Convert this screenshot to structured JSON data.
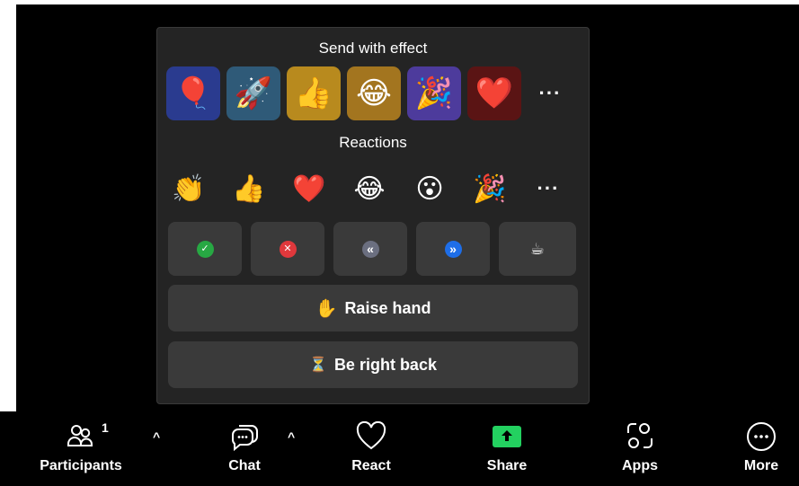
{
  "popup": {
    "effects_title": "Send with effect",
    "effects": [
      {
        "emoji": "🎈",
        "name": "balloon",
        "bg": "#2a3b8f"
      },
      {
        "emoji": "🚀",
        "name": "rocket",
        "bg": "#2f5a78"
      },
      {
        "emoji": "👍",
        "name": "thumbs-up",
        "bg": "#b88a1e"
      },
      {
        "emoji": "😂",
        "name": "laughing",
        "bg": "#a3751f"
      },
      {
        "emoji": "🎉",
        "name": "party",
        "bg": "#4d3b9c"
      },
      {
        "emoji": "❤️",
        "name": "heart",
        "bg": "#5a1414"
      }
    ],
    "effects_more": "···",
    "reactions_title": "Reactions",
    "reactions": [
      {
        "emoji": "👏",
        "name": "clap"
      },
      {
        "emoji": "👍",
        "name": "thumbs-up"
      },
      {
        "emoji": "❤️",
        "name": "heart"
      },
      {
        "emoji": "😂",
        "name": "laughing"
      },
      {
        "emoji": "😮",
        "name": "surprised"
      },
      {
        "emoji": "🎉",
        "name": "party"
      }
    ],
    "reactions_more": "···",
    "status": [
      {
        "name": "yes",
        "symbol": "✓",
        "color": "#27a843"
      },
      {
        "name": "no",
        "symbol": "✕",
        "color": "#e0383c"
      },
      {
        "name": "slow-down",
        "symbol": "«",
        "color": "#6b6f80"
      },
      {
        "name": "speed-up",
        "symbol": "»",
        "color": "#1e6ee8"
      },
      {
        "name": "coffee",
        "symbol": "☕",
        "color": ""
      }
    ],
    "raise_hand": {
      "emoji": "✋",
      "label": "Raise hand"
    },
    "be_right_back": {
      "emoji": "⏳",
      "label": "Be right back"
    }
  },
  "toolbar": {
    "participants": {
      "label": "Participants",
      "count": "1"
    },
    "chat": {
      "label": "Chat"
    },
    "react": {
      "label": "React"
    },
    "share": {
      "label": "Share",
      "color": "#23d160"
    },
    "apps": {
      "label": "Apps"
    },
    "more": {
      "label": "More"
    },
    "caret": "^"
  }
}
